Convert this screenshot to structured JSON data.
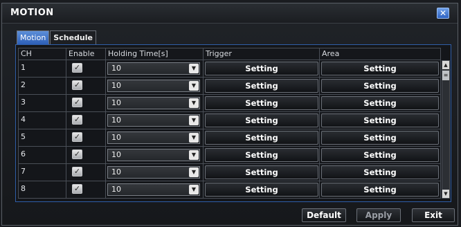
{
  "window": {
    "title": "MOTION",
    "close_icon": "close-icon"
  },
  "tabs": [
    {
      "label": "Motion",
      "active": true
    },
    {
      "label": "Schedule",
      "active": false
    }
  ],
  "table": {
    "headers": [
      "CH",
      "Enable",
      "Holding Time[s]",
      "Trigger",
      "Area"
    ],
    "rows": [
      {
        "ch": "1",
        "enabled": true,
        "holding_time": "10",
        "trigger": "Setting",
        "area": "Setting"
      },
      {
        "ch": "2",
        "enabled": true,
        "holding_time": "10",
        "trigger": "Setting",
        "area": "Setting"
      },
      {
        "ch": "3",
        "enabled": true,
        "holding_time": "10",
        "trigger": "Setting",
        "area": "Setting"
      },
      {
        "ch": "4",
        "enabled": true,
        "holding_time": "10",
        "trigger": "Setting",
        "area": "Setting"
      },
      {
        "ch": "5",
        "enabled": true,
        "holding_time": "10",
        "trigger": "Setting",
        "area": "Setting"
      },
      {
        "ch": "6",
        "enabled": true,
        "holding_time": "10",
        "trigger": "Setting",
        "area": "Setting"
      },
      {
        "ch": "7",
        "enabled": true,
        "holding_time": "10",
        "trigger": "Setting",
        "area": "Setting"
      },
      {
        "ch": "8",
        "enabled": true,
        "holding_time": "10",
        "trigger": "Setting",
        "area": "Setting"
      }
    ]
  },
  "footer": {
    "default_label": "Default",
    "apply_label": "Apply",
    "exit_label": "Exit"
  },
  "colors": {
    "accent": "#2f63c2",
    "background": "#1a1c20",
    "border": "#4a4f57"
  }
}
